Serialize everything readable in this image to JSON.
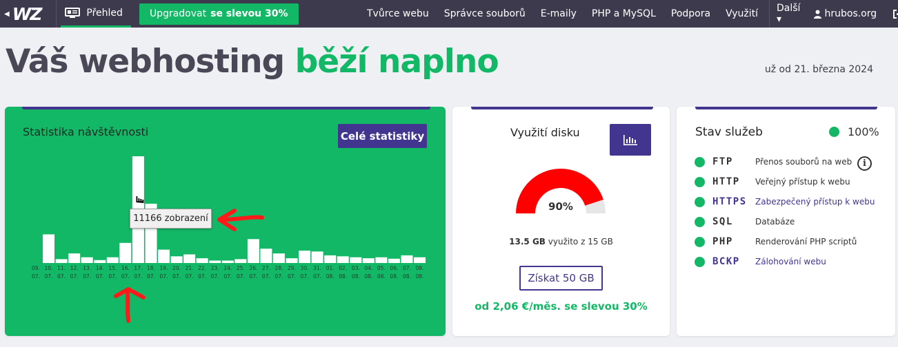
{
  "nav": {
    "back_icon": "chevron-left-icon",
    "logo": "WZ",
    "overview_label": "Přehled",
    "upgrade_label": "Upgradovat",
    "upgrade_discount": "se slevou 30%",
    "links": [
      "Tvůrce webu",
      "Správce souborů",
      "E-maily",
      "PHP a MySQL",
      "Podpora",
      "Využití"
    ],
    "more_label": "Další ▾",
    "account": "hrubos.org"
  },
  "headline": {
    "part1": "Váš webhosting",
    "part2": "běží naplno",
    "since": "už od 21. března 2024"
  },
  "stats": {
    "title": "Statistika návštěvnosti",
    "full_stats_button": "Celé statistiky",
    "tooltip": "11166 zobrazení"
  },
  "chart_data": {
    "type": "bar",
    "categories": [
      "09. 07.",
      "10. 07.",
      "11. 07.",
      "12. 07.",
      "13. 07.",
      "14. 07.",
      "15. 07.",
      "16. 07.",
      "17. 07.",
      "18. 07.",
      "19. 07.",
      "20. 07.",
      "21. 07.",
      "22. 07.",
      "23. 07.",
      "24. 07.",
      "25. 07.",
      "26. 07.",
      "27. 07.",
      "28. 07.",
      "29. 07.",
      "30. 07.",
      "31. 07.",
      "01. 08.",
      "02. 08.",
      "03. 08.",
      "04. 08.",
      "05. 08.",
      "06. 08.",
      "07. 08.",
      "08. 08."
    ],
    "values": [
      0,
      3000,
      400,
      1000,
      600,
      300,
      600,
      2100,
      11166,
      6200,
      1400,
      700,
      900,
      500,
      250,
      250,
      400,
      2500,
      1500,
      1000,
      500,
      1300,
      1200,
      800,
      700,
      600,
      500,
      600,
      450,
      800,
      600
    ],
    "title": "",
    "xlabel": "",
    "ylabel": "",
    "ylim": [
      0,
      11166
    ],
    "grid": false,
    "bar_color": "#ffffff",
    "background": "#13b866"
  },
  "disk": {
    "title": "Využití disku",
    "chart_icon": "bar-chart-icon",
    "percent": 90,
    "percent_label": "90%",
    "used": "13.5 GB",
    "used_suffix": "využito z 15 GB",
    "button": "Získat 50 GB",
    "price": "od 2,06 €/měs. se slevou 30%"
  },
  "services": {
    "title": "Stav služeb",
    "status": "100%",
    "items": [
      {
        "code": "FTP",
        "desc": "Přenos souborů na web"
      },
      {
        "code": "HTTP",
        "desc": "Veřejný přístup k webu"
      },
      {
        "code": "HTTPS",
        "desc": "Zabezpečený přístup k webu"
      },
      {
        "code": "SQL",
        "desc": "Databáze"
      },
      {
        "code": "PHP",
        "desc": "Renderování PHP scriptů"
      },
      {
        "code": "BCKP",
        "desc": "Zálohování webu"
      }
    ]
  },
  "colors": {
    "green": "#13b866",
    "purple": "#41358f",
    "topbar": "#3d3a4e",
    "gauge": "#ff0000",
    "annotation": "#ff1a1a"
  }
}
